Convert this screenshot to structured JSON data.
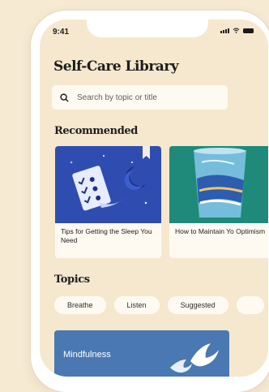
{
  "status_bar": {
    "time": "9:41"
  },
  "header": {
    "title": "Self-Care Library"
  },
  "search": {
    "placeholder": "Search by topic or title"
  },
  "recommended": {
    "heading": "Recommended",
    "cards": [
      {
        "title": "Tips for Getting the Sleep You Need"
      },
      {
        "title": "How to Maintain Yo Optimism"
      }
    ]
  },
  "topics": {
    "heading": "Topics",
    "chips": [
      "Breathe",
      "Listen",
      "Suggested",
      ""
    ]
  },
  "banner": {
    "label": "Mindfulness"
  },
  "colors": {
    "background": "#f6ead2",
    "screen": "#f5e8cf",
    "card": "#fffaf1",
    "sleep_art": "#2f4db0",
    "optimism_art": "#1f8a7a",
    "banner": "#4a78b2"
  }
}
